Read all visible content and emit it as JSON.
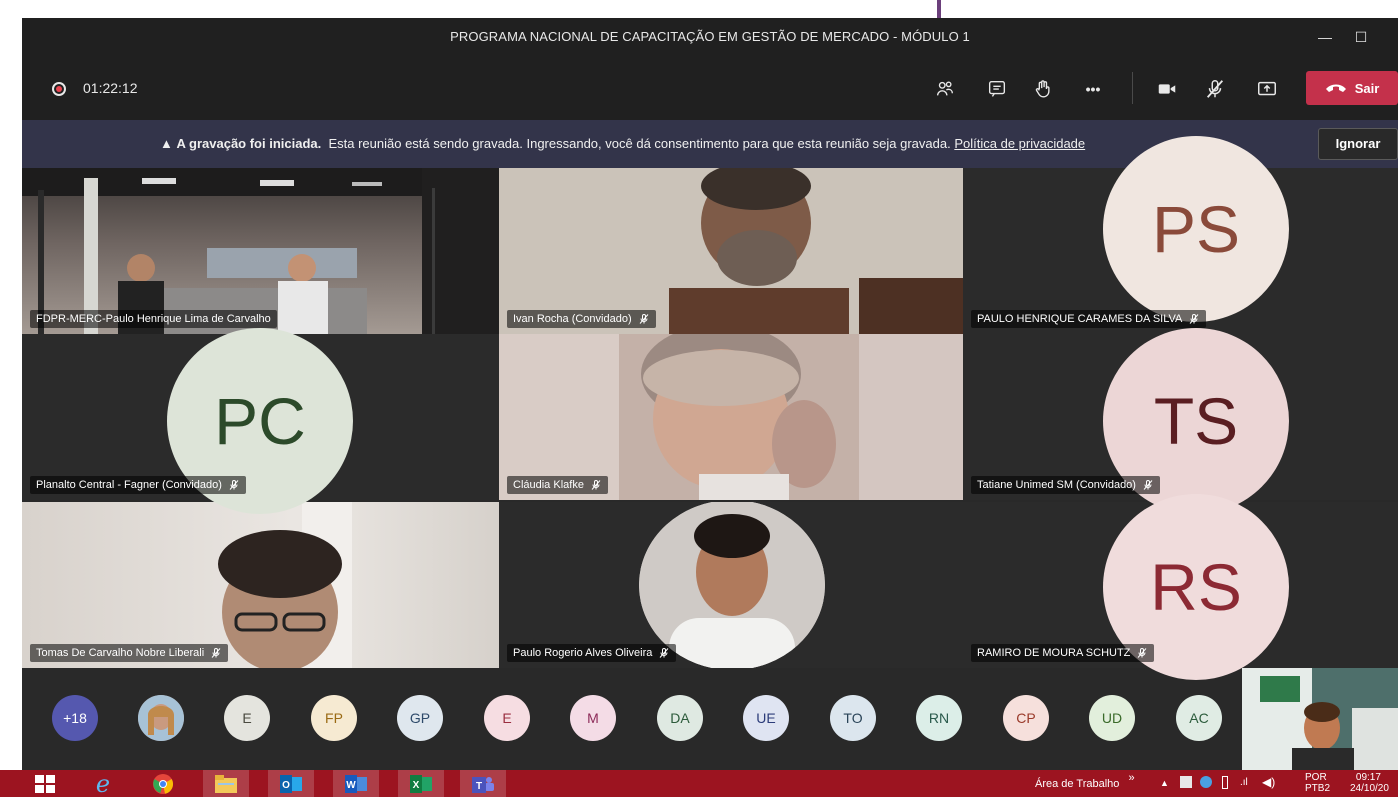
{
  "window": {
    "title": "PROGRAMA NACIONAL DE CAPACITAÇÃO EM GESTÃO DE MERCADO - MÓDULO 1",
    "minimize_glyph": "—",
    "maximize_glyph": "☐"
  },
  "controls": {
    "timer": "01:22:12",
    "leave_label": "Sair",
    "icons": [
      "participants-icon",
      "chat-icon",
      "raise-hand-icon",
      "more-actions-icon",
      "camera-icon",
      "mic-off-icon",
      "share-screen-icon",
      "hang-up-icon"
    ],
    "more_glyph": "•••"
  },
  "banner": {
    "title": "A gravação foi iniciada.",
    "message": "Esta reunião está sendo gravada. Ingressando, você dá consentimento para que esta reunião seja gravada.",
    "link": "Política de privacidade",
    "dismiss_label": "Ignorar"
  },
  "participants": [
    {
      "name": "FDPR-MERC-Paulo Henrique Lima de Carvalho",
      "kind": "video",
      "muted": false
    },
    {
      "name": "Ivan Rocha (Convidado)",
      "kind": "video",
      "muted": true
    },
    {
      "name": "PAULO HENRIQUE CARAMES DA SILVA",
      "kind": "avatar",
      "initials": "PS",
      "muted": true
    },
    {
      "name": "Planalto Central - Fagner (Convidado)",
      "kind": "avatar",
      "initials": "PC",
      "muted": true
    },
    {
      "name": "Cláudia Klafke",
      "kind": "video",
      "muted": true
    },
    {
      "name": "Tatiane Unimed SM (Convidado)",
      "kind": "avatar",
      "initials": "TS",
      "muted": true
    },
    {
      "name": "Tomas De Carvalho Nobre Liberali",
      "kind": "video",
      "muted": true
    },
    {
      "name": "Paulo Rogerio Alves Oliveira",
      "kind": "photo",
      "muted": true
    },
    {
      "name": "RAMIRO DE MOURA SCHUTZ",
      "kind": "avatar",
      "initials": "RS",
      "muted": true
    }
  ],
  "tray": {
    "overflow": "+18",
    "avatars": [
      "E",
      "FP",
      "GP",
      "E",
      "M",
      "DA",
      "UE",
      "TO",
      "RN",
      "CP",
      "UD",
      "AC"
    ]
  },
  "colors": {
    "leave": "#c4314b",
    "banner": "#33344a",
    "taskbar": "#9c1420",
    "overflow_avatar": "#5558af"
  },
  "taskbar": {
    "apps": [
      "windows-start-icon",
      "internet-explorer-icon",
      "chrome-icon",
      "file-explorer-icon",
      "outlook-icon",
      "word-icon",
      "excel-icon",
      "teams-icon"
    ],
    "desktop_label": "Área de Trabalho",
    "chevron": "»",
    "language": "POR",
    "language_sub": "PTB2",
    "time": "09:17",
    "date": "24/10/20"
  }
}
